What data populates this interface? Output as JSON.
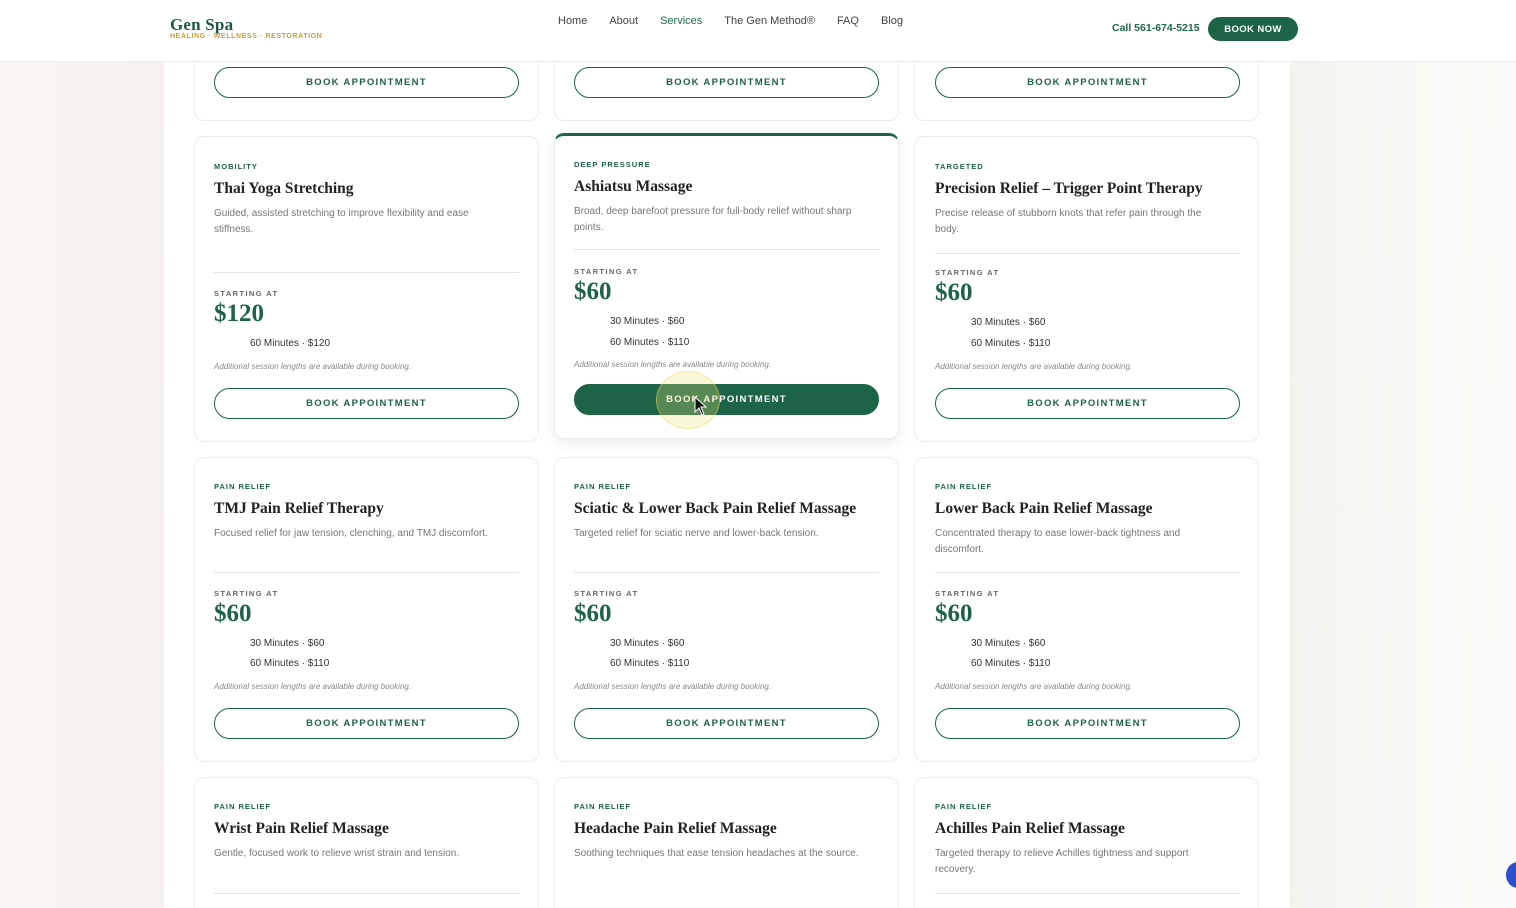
{
  "header": {
    "logo": {
      "name": "Gen Spa",
      "tagline": "HEALING · WELLNESS · RESTORATION"
    },
    "nav": [
      "Home",
      "About",
      "Services",
      "The Gen Method®",
      "FAQ",
      "Blog"
    ],
    "active_nav": "Services",
    "phone": "Call 561-674-5215",
    "book_now": "BOOK NOW"
  },
  "labels": {
    "starting_at": "STARTING AT",
    "note": "Additional session lengths are available during booking.",
    "book": "BOOK APPOINTMENT"
  },
  "cards": [
    {
      "category": "MOBILITY",
      "title": "Thai Yoga Stretching",
      "desc": "Guided, assisted stretching to improve flexibility and ease stiffness.",
      "price": "$120",
      "tiers": [
        "60 Minutes · $120"
      ]
    },
    {
      "category": "DEEP PRESSURE",
      "title": "Ashiatsu Massage",
      "desc": "Broad, deep barefoot pressure for full-body relief without sharp points.",
      "price": "$60",
      "tiers": [
        "30 Minutes · $60",
        "60 Minutes · $110"
      ]
    },
    {
      "category": "TARGETED",
      "title": "Precision Relief – Trigger Point Therapy",
      "desc": "Precise release of stubborn knots that refer pain through the body.",
      "price": "$60",
      "tiers": [
        "30 Minutes · $60",
        "60 Minutes · $110"
      ]
    },
    {
      "category": "PAIN RELIEF",
      "title": "TMJ Pain Relief Therapy",
      "desc": "Focused relief for jaw tension, clenching, and TMJ discomfort.",
      "price": "$60",
      "tiers": [
        "30 Minutes · $60",
        "60 Minutes · $110"
      ]
    },
    {
      "category": "PAIN RELIEF",
      "title": "Sciatic & Lower Back Pain Relief Massage",
      "desc": "Targeted relief for sciatic nerve and lower-back tension.",
      "price": "$60",
      "tiers": [
        "30 Minutes · $60",
        "60 Minutes · $110"
      ]
    },
    {
      "category": "PAIN RELIEF",
      "title": "Lower Back Pain Relief Massage",
      "desc": "Concentrated therapy to ease lower-back tightness and discomfort.",
      "price": "$60",
      "tiers": [
        "30 Minutes · $60",
        "60 Minutes · $110"
      ]
    },
    {
      "category": "PAIN RELIEF",
      "title": "Wrist Pain Relief Massage",
      "desc": "Gentle, focused work to relieve wrist strain and tension."
    },
    {
      "category": "PAIN RELIEF",
      "title": "Headache Pain Relief Massage",
      "desc": "Soothing techniques that ease tension headaches at the source."
    },
    {
      "category": "PAIN RELIEF",
      "title": "Achilles Pain Relief Massage",
      "desc": "Targeted therapy to relieve Achilles tightness and support recovery."
    }
  ]
}
